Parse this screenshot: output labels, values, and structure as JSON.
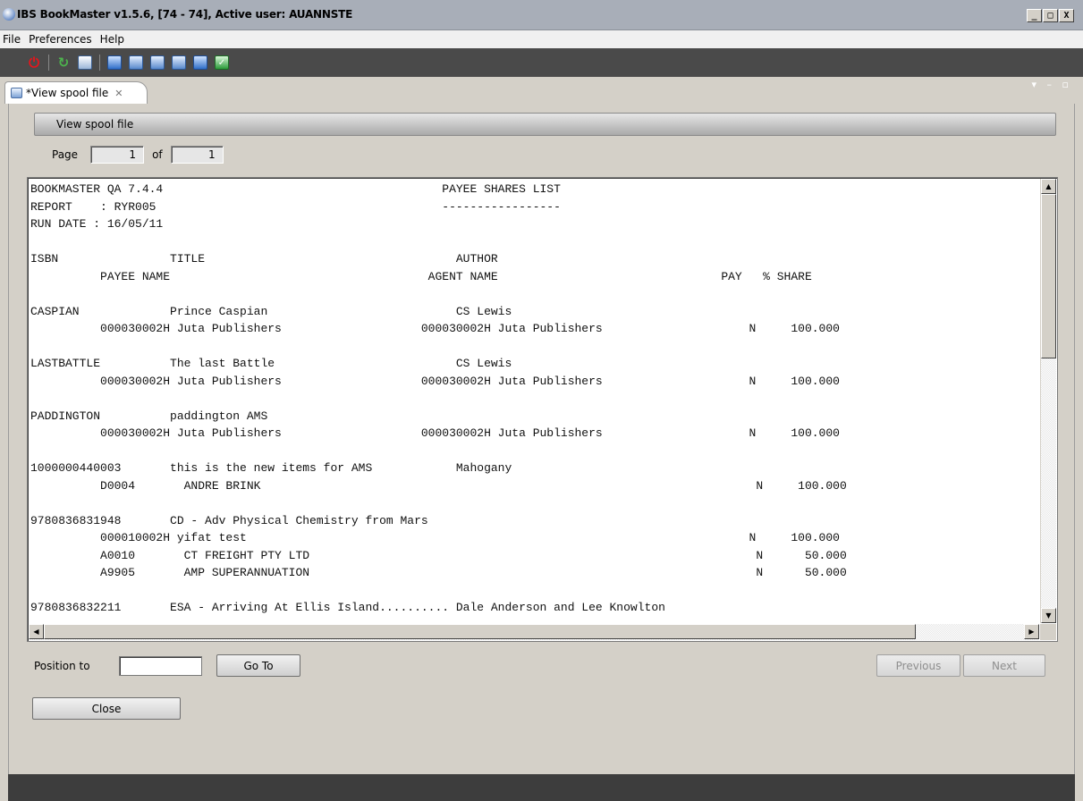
{
  "window": {
    "title": "IBS BookMaster v1.5.6,  [74 - 74], Active user: AUANNSTE",
    "controls": [
      "_",
      "□",
      "X"
    ]
  },
  "menu": [
    "File",
    "Preferences",
    "Help"
  ],
  "toolbar": {
    "icons": [
      "power-icon",
      "refresh-icon",
      "print-icon",
      "view-list-icon",
      "save-icon",
      "preview-icon",
      "search-icon",
      "report-icon",
      "approve-icon"
    ]
  },
  "tab": {
    "label": "*View spool file",
    "close": "✕",
    "view_controls": "▾ – ▫"
  },
  "section": {
    "title": "View spool file"
  },
  "pager": {
    "page_label": "Page",
    "page_value": "1",
    "of_label": "of",
    "total_value": "1"
  },
  "report": {
    "lines": [
      "BOOKMASTER QA 7.4.4                                        PAYEE SHARES LIST",
      "REPORT    : RYR005                                         -----------------",
      "RUN DATE : 16/05/11",
      "",
      "ISBN                TITLE                                    AUTHOR",
      "          PAYEE NAME                                     AGENT NAME                                PAY   % SHARE",
      "",
      "CASPIAN             Prince Caspian                           CS Lewis",
      "          000030002H Juta Publishers                    000030002H Juta Publishers                     N     100.000",
      "",
      "LASTBATTLE          The last Battle                          CS Lewis",
      "          000030002H Juta Publishers                    000030002H Juta Publishers                     N     100.000",
      "",
      "PADDINGTON          paddington AMS",
      "          000030002H Juta Publishers                    000030002H Juta Publishers                     N     100.000",
      "",
      "1000000440003       this is the new items for AMS            Mahogany",
      "          D0004       ANDRE BRINK                                                                       N     100.000",
      "",
      "9780836831948       CD - Adv Physical Chemistry from Mars",
      "          000010002H yifat test                                                                        N     100.000",
      "          A0010       CT FREIGHT PTY LTD                                                                N      50.000",
      "          A9905       AMP SUPERANNUATION                                                                N      50.000",
      "",
      "9780836832211       ESA - Arriving At Ellis Island.......... Dale Anderson and Lee Knowlton"
    ]
  },
  "position": {
    "label": "Position to",
    "value": "",
    "placeholder": ""
  },
  "buttons": {
    "goto": "Go To",
    "previous": "Previous",
    "next": "Next",
    "close": "Close"
  }
}
